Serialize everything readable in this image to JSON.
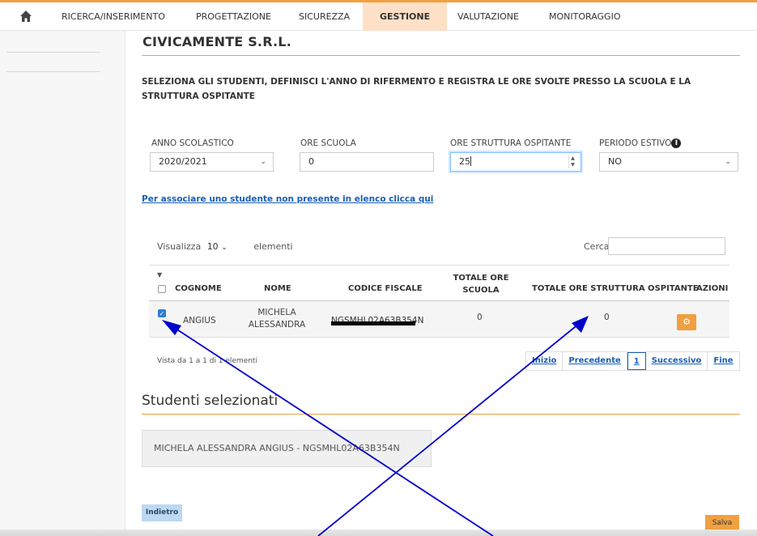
{
  "nav": {
    "items": [
      {
        "label": "RICERCA/INSERIMENTO"
      },
      {
        "label": "PROGETTAZIONE"
      },
      {
        "label": "SICUREZZA"
      },
      {
        "label": "GESTIONE"
      },
      {
        "label": "VALUTAZIONE"
      },
      {
        "label": "MONITORAGGIO"
      }
    ],
    "active": "GESTIONE"
  },
  "page": {
    "company": "CIVICAMENTE S.R.L.",
    "instructions": "SELEZIONA GLI STUDENTI, DEFINISCI L'ANNO DI RIFERMENTO E REGISTRA LE ORE SVOLTE PRESSO LA SCUOLA E LA STRUTTURA OSPITANTE"
  },
  "form": {
    "anno_label": "ANNO SCOLASTICO",
    "anno_value": "2020/2021",
    "ore_scuola_label": "ORE SCUOLA",
    "ore_scuola_value": "0",
    "ore_struttura_label": "ORE STRUTTURA OSPITANTE",
    "ore_struttura_value": "25",
    "periodo_label": "PERIODO ESTIVO",
    "periodo_value": "NO"
  },
  "assoc_link": "Per associare uno studente non presente in elenco clicca qui",
  "table": {
    "show_label": "Visualizza",
    "show_value": "10",
    "show_suffix": "elementi",
    "search_label": "Cerca:",
    "headers": {
      "cognome": "COGNOME",
      "nome": "NOME",
      "codice": "CODICE FISCALE",
      "ore_scuola_1": "TOTALE ORE",
      "ore_scuola_2": "SCUOLA",
      "ore_struttura": "TOTALE ORE STRUTTURA OSPITANTE",
      "azioni": "AZIONI"
    },
    "rows": [
      {
        "checked": true,
        "cognome": "ANGIUS",
        "nome_1": "MICHELA",
        "nome_2": "ALESSANDRA",
        "codice": "NGSMHL02A63B354N",
        "ore_scuola": "0",
        "ore_struttura": "0"
      }
    ],
    "info": "Vista da 1 a 1 di 1 elementi",
    "pager": {
      "first": "Inizio",
      "prev": "Precedente",
      "page": "1",
      "next": "Successivo",
      "last": "Fine"
    }
  },
  "selected": {
    "title": "Studenti selezionati",
    "item": "MICHELA ALESSANDRA ANGIUS - NGSMHL02A63B354N"
  },
  "buttons": {
    "back": "Indietro",
    "save": "Salva"
  },
  "colors": {
    "accent": "#f0a040",
    "link": "#1a5fb4",
    "annotation": "#0000cc"
  },
  "icons": {
    "home": "home-icon",
    "info": "info-icon",
    "gear": "gear-icon"
  }
}
